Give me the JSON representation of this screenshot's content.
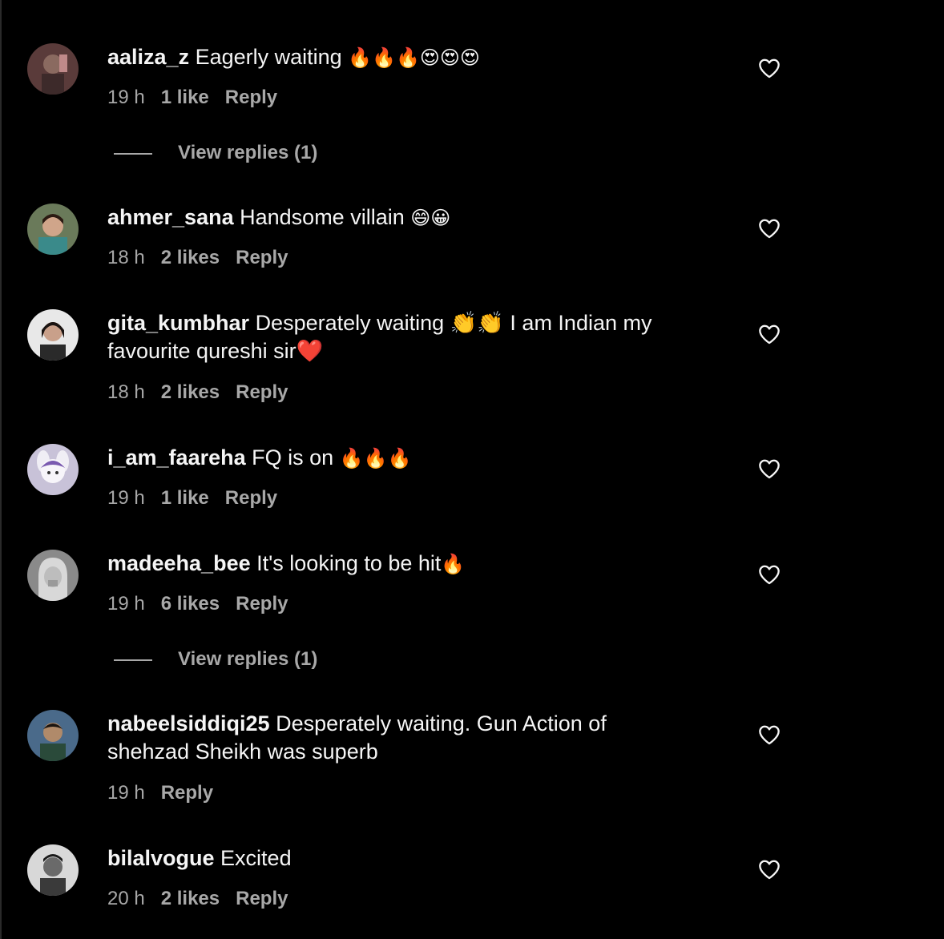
{
  "comments": [
    {
      "username": "aaliza_z",
      "text": "Eagerly waiting ",
      "emoji": "🔥🔥🔥😍😍😍",
      "time": "19 h",
      "likes": "1 like",
      "reply": "Reply",
      "view_replies": "View replies (1)"
    },
    {
      "username": "ahmer_sana",
      "text": "Handsome villain ",
      "emoji": "😄😀",
      "time": "18 h",
      "likes": "2 likes",
      "reply": "Reply"
    },
    {
      "username": "gita_kumbhar",
      "text": "Desperately waiting 👏👏 I am Indian my favourite qureshi sir❤️",
      "emoji": "",
      "time": "18 h",
      "likes": "2 likes",
      "reply": "Reply"
    },
    {
      "username": "i_am_faareha",
      "text": "FQ is on ",
      "emoji": "🔥🔥🔥",
      "time": "19 h",
      "likes": "1 like",
      "reply": "Reply"
    },
    {
      "username": "madeeha_bee",
      "text": "It's looking to be hit",
      "emoji": "🔥",
      "time": "19 h",
      "likes": "6 likes",
      "reply": "Reply",
      "view_replies": "View replies (1)"
    },
    {
      "username": "nabeelsiddiqi25",
      "text": "Desperately waiting. Gun Action of shehzad Sheikh was superb",
      "emoji": "",
      "time": "19 h",
      "likes": "",
      "reply": "Reply"
    },
    {
      "username": "bilalvogue",
      "text": "Excited",
      "emoji": "",
      "time": "20 h",
      "likes": "2 likes",
      "reply": "Reply"
    }
  ],
  "colors": {
    "background": "#000000",
    "text": "#f5f5f5",
    "secondary": "#a8a8a8"
  },
  "icons": {
    "like": "heart-outline-icon"
  }
}
